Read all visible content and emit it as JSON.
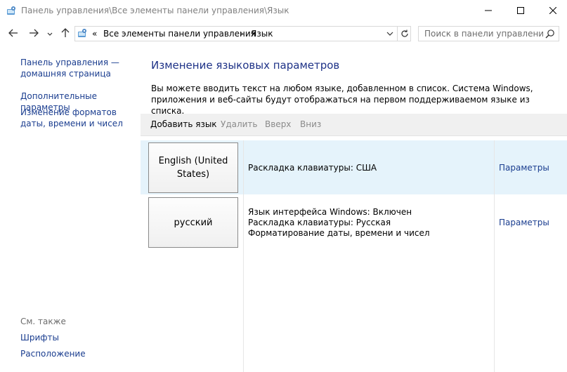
{
  "window": {
    "title": "Панель управления\\Все элементы панели управления\\Язык"
  },
  "address": {
    "overflow": "«",
    "crumb1": "Все элементы панели управления",
    "separator": "›",
    "crumb2": "Язык"
  },
  "search": {
    "placeholder": "Поиск в панели управления"
  },
  "sidebar": {
    "home": "Панель управления — домашняя страница",
    "advanced": "Дополнительные параметры",
    "formats": "Изменение форматов даты, времени и чисел",
    "see_also": "См. также",
    "fonts": "Шрифты",
    "location": "Расположение"
  },
  "main": {
    "heading": "Изменение языковых параметров",
    "description": "Вы можете вводить текст на любом языке, добавленном в список. Система Windows, приложения и веб-сайты будут отображаться на первом поддерживаемом языке из списка."
  },
  "toolbar": {
    "add": "Добавить язык",
    "remove": "Удалить",
    "up": "Вверх",
    "down": "Вниз"
  },
  "languages": [
    {
      "name": "English (United States)",
      "details": [
        "Раскладка клавиатуры: США"
      ],
      "options": "Параметры"
    },
    {
      "name": "русский",
      "details": [
        "Язык интерфейса Windows: Включен",
        "Раскладка клавиатуры: Русская",
        "Форматирование даты, времени и чисел"
      ],
      "options": "Параметры"
    }
  ],
  "colors": {
    "link": "#1a3d8f",
    "heading": "#1e3287",
    "selected_row": "#e5f3fb",
    "toolbar_bg": "#f0f0f0",
    "disabled_text": "#8a8a8a"
  },
  "icons": {
    "app": "control-panel-icon",
    "minimize": "minimize-icon",
    "maximize": "maximize-icon",
    "close": "close-icon",
    "back": "arrow-left-icon",
    "forward": "arrow-right-icon",
    "recent": "chevron-down-icon",
    "up": "arrow-up-icon",
    "refresh": "refresh-icon",
    "search": "search-icon"
  }
}
